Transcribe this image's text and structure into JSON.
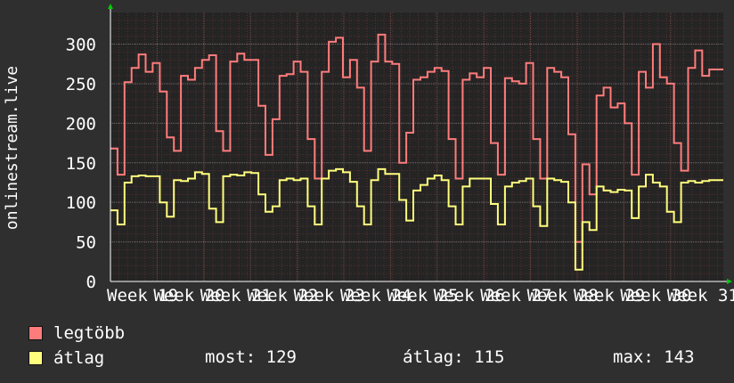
{
  "chart_data": {
    "type": "line",
    "ylabel": "onlinestream.live",
    "ylim": [
      0,
      340
    ],
    "y_ticks": [
      "0",
      "50",
      "100",
      "150",
      "200",
      "250",
      "300"
    ],
    "x_ticks": [
      "Week 19",
      "Week 20",
      "Week 21",
      "Week 22",
      "Week 23",
      "Week 24",
      "Week 25",
      "Week 26",
      "Week 27",
      "Week 28",
      "Week 29",
      "Week 30",
      "Week 31"
    ],
    "grid": true,
    "colors": {
      "background": "#2f2f2f",
      "plot_bg": "#242424",
      "grid_minor": "#5a3030",
      "grid_major": "#3c3c3c",
      "axis": "#ffffff",
      "arrow": "#00cc00"
    },
    "series": [
      {
        "name": "legtöbb",
        "color": "#ff7c7c",
        "values": [
          168,
          135,
          252,
          270,
          287,
          265,
          276,
          240,
          182,
          165,
          260,
          255,
          270,
          280,
          286,
          190,
          165,
          278,
          288,
          280,
          280,
          222,
          160,
          205,
          260,
          262,
          278,
          265,
          180,
          130,
          265,
          303,
          308,
          258,
          280,
          245,
          165,
          278,
          312,
          278,
          275,
          150,
          188,
          255,
          258,
          265,
          270,
          266,
          180,
          130,
          255,
          263,
          258,
          270,
          175,
          135,
          257,
          253,
          250,
          276,
          180,
          130,
          270,
          265,
          258,
          186,
          50,
          148,
          110,
          235,
          245,
          220,
          225,
          200,
          135,
          265,
          245,
          300,
          258,
          250,
          175,
          140,
          270,
          292,
          260,
          268,
          268
        ]
      },
      {
        "name": "átlag",
        "color": "#ffff7c",
        "values": [
          90,
          72,
          125,
          133,
          134,
          133,
          133,
          100,
          82,
          128,
          127,
          130,
          138,
          136,
          92,
          75,
          133,
          135,
          134,
          138,
          137,
          110,
          88,
          95,
          128,
          130,
          128,
          130,
          95,
          72,
          130,
          140,
          142,
          138,
          126,
          95,
          72,
          128,
          142,
          136,
          136,
          103,
          77,
          115,
          122,
          130,
          134,
          128,
          95,
          72,
          120,
          130,
          130,
          130,
          98,
          72,
          120,
          125,
          127,
          130,
          95,
          70,
          130,
          128,
          126,
          100,
          15,
          75,
          65,
          120,
          115,
          113,
          116,
          115,
          80,
          120,
          135,
          125,
          120,
          88,
          75,
          125,
          127,
          125,
          127,
          128,
          128
        ]
      }
    ]
  },
  "legend": [
    {
      "label": "legtöbb",
      "color": "#ff7c7c"
    },
    {
      "label": "átlag",
      "color": "#ffff7c"
    }
  ],
  "stats": {
    "most": "most: 129",
    "atlag": "átlag: 115",
    "max": "max: 143"
  }
}
